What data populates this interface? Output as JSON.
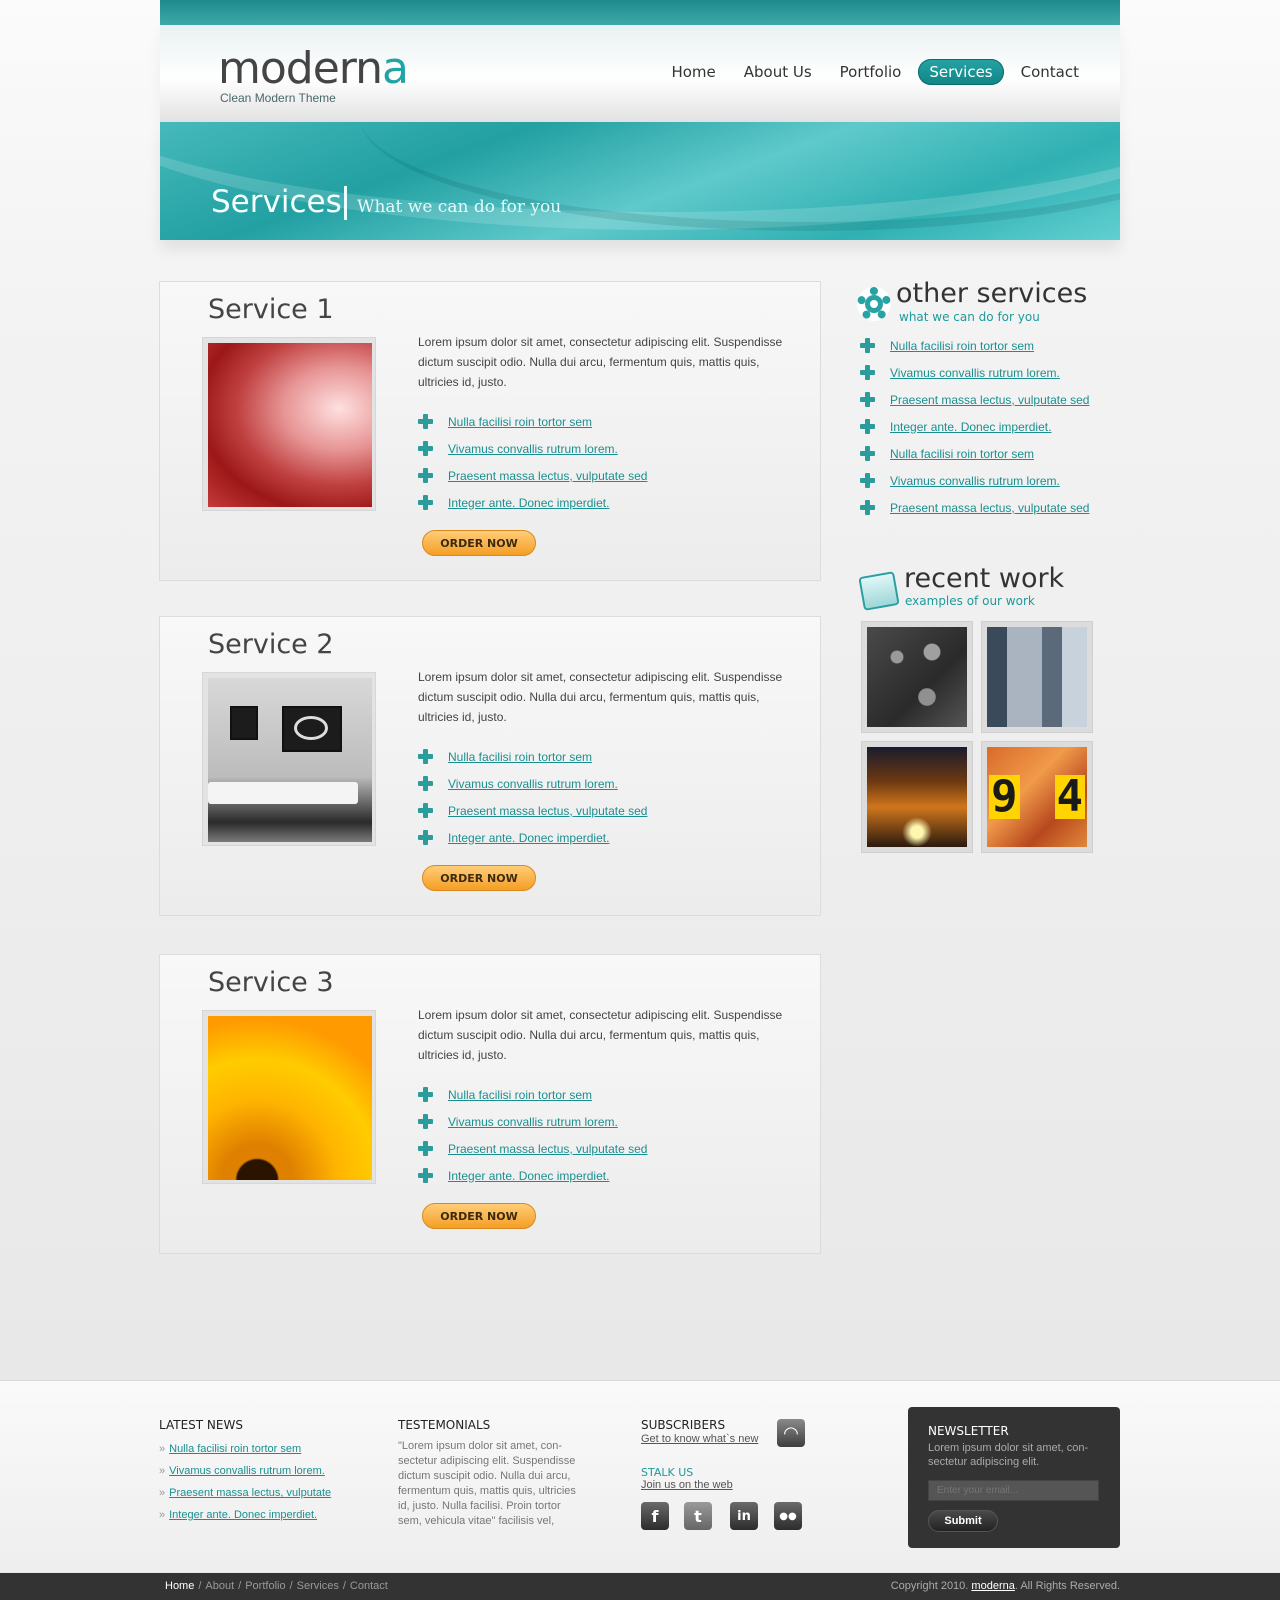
{
  "header": {
    "logo_main": "modern",
    "logo_accent": "a",
    "tagline": "Clean Modern Theme",
    "nav": [
      "Home",
      "About Us",
      "Portfolio",
      "Services",
      "Contact"
    ],
    "active_nav": "Services",
    "accent_color": "#23a4a4"
  },
  "banner": {
    "title": "Services",
    "subtitle": "What we can do for you"
  },
  "services": [
    {
      "title": "Service 1",
      "description": "Lorem ipsum dolor sit amet, consectetur adipiscing elit. Suspendisse dictum suscipit odio. Nulla dui arcu, fermentum quis, mattis quis, ultricies id, justo.",
      "links": [
        "Nulla facilisi roin tortor sem",
        "Vivamus convallis rutrum lorem. ",
        "Praesent massa lectus, vulputate sed",
        "Integer ante. Donec imperdiet. "
      ],
      "button": "ORDER NOW"
    },
    {
      "title": "Service 2",
      "description": "Lorem ipsum dolor sit amet, consectetur adipiscing elit. Suspendisse dictum suscipit odio. Nulla dui arcu, fermentum quis, mattis quis, ultricies id, justo.",
      "links": [
        "Nulla facilisi roin tortor sem",
        "Vivamus convallis rutrum lorem. ",
        "Praesent massa lectus, vulputate sed",
        "Integer ante. Donec imperdiet. "
      ],
      "button": "ORDER NOW"
    },
    {
      "title": "Service 3",
      "description": "Lorem ipsum dolor sit amet, consectetur adipiscing elit. Suspendisse dictum suscipit odio. Nulla dui arcu, fermentum quis, mattis quis, ultricies id, justo.",
      "links": [
        "Nulla facilisi roin tortor sem",
        "Vivamus convallis rutrum lorem. ",
        "Praesent massa lectus, vulputate sed",
        "Integer ante. Donec imperdiet. "
      ],
      "button": "ORDER NOW"
    }
  ],
  "sidebar": {
    "other_title": "other services",
    "other_subtitle": "what we can do for you",
    "other_links": [
      "Nulla facilisi roin tortor sem",
      "Vivamus convallis rutrum lorem. ",
      "Praesent massa lectus, vulputate sed",
      "Integer ante. Donec imperdiet. ",
      "Nulla facilisi roin tortor sem",
      "Vivamus convallis rutrum lorem. ",
      "Praesent massa lectus, vulputate sed"
    ],
    "work_title": "recent work",
    "work_subtitle": "examples of our work"
  },
  "footer": {
    "news_title": "LATEST NEWS",
    "news_links": [
      "Nulla facilisi roin tortor sem",
      "Vivamus convallis rutrum lorem. ",
      "Praesent massa lectus, vulputate",
      "Integer ante. Donec imperdiet. "
    ],
    "testimonial_title": "TESTEMONIALS",
    "testimonial_text": "\"Lorem ipsum dolor sit amet, con-sectetur adipiscing elit. Suspendisse dictum suscipit odio. Nulla dui arcu, fermentum quis, mattis quis, ultricies id, justo. Nulla facilisi. Proin tortor sem, vehicula vitae\" facilisis vel,",
    "subscribers_title": "SUBSCRIBERS",
    "subscribers_link": "Get to know what`s new",
    "stalk_title": "STALK US",
    "stalk_link": "Join us on the web",
    "social": [
      "f",
      "t",
      "in",
      "●●"
    ],
    "newsletter_title": "NEWSLETTER",
    "newsletter_text": "Lorem ipsum dolor sit amet, con-sectetur adipiscing elit.",
    "newsletter_placeholder": "Enter your email...",
    "newsletter_button": "Submit"
  },
  "bottom": {
    "nav": [
      "Home",
      "About",
      "Portfolio",
      "Services",
      "Contact"
    ],
    "copyright_pre": "Copyright 2010.",
    "copyright_brand": "moderna",
    "copyright_post": ". All Rights Reserved."
  },
  "icons": [
    "plus-icon",
    "gear-icon",
    "recent-work-icon",
    "rss-icon",
    "facebook-icon",
    "twitter-icon",
    "linkedin-icon",
    "flickr-icon"
  ]
}
